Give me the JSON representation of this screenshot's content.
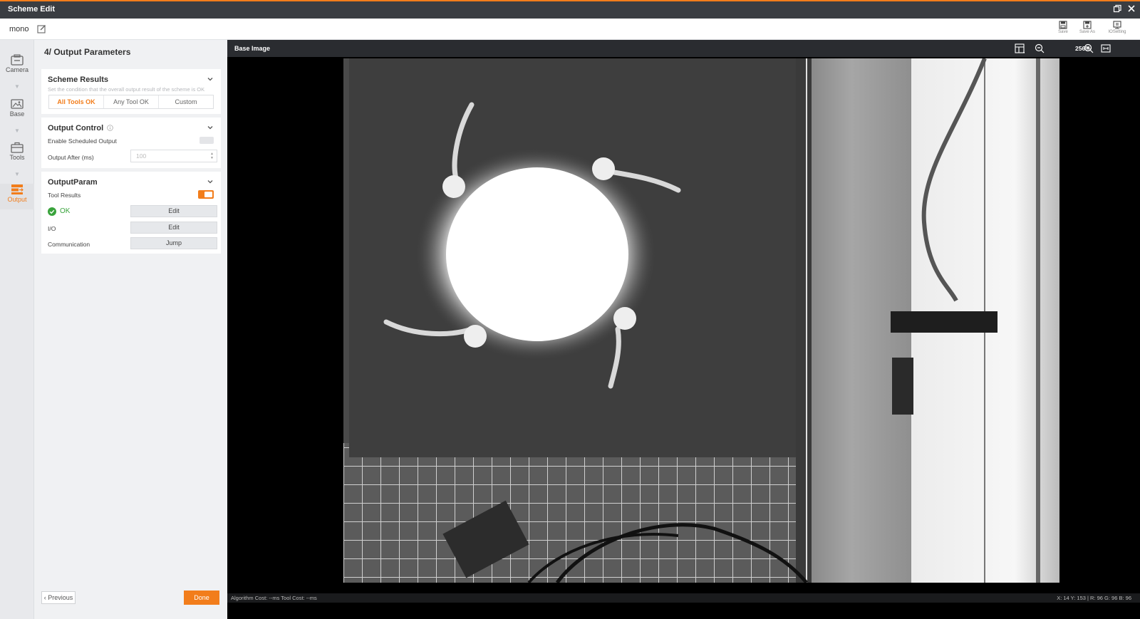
{
  "window": {
    "title": "Scheme Edit"
  },
  "toolbar": {
    "scheme_name": "mono",
    "actions": [
      {
        "label": "Save",
        "icon": "save-icon"
      },
      {
        "label": "Save As",
        "icon": "save-as-icon"
      },
      {
        "label": "IOSetting",
        "icon": "io-setting-icon"
      }
    ]
  },
  "leftnav": {
    "items": [
      {
        "label": "Camera",
        "icon": "camera-icon"
      },
      {
        "label": "Base",
        "icon": "image-icon"
      },
      {
        "label": "Tools",
        "icon": "toolbox-icon"
      },
      {
        "label": "Output",
        "icon": "output-icon",
        "active": true
      }
    ]
  },
  "panel": {
    "title": "4/ Output Parameters",
    "scheme_results": {
      "title": "Scheme Results",
      "description": "Set the condition that the overall output result of the scheme is OK",
      "options": [
        "All Tools OK",
        "Any Tool OK",
        "Custom"
      ],
      "selected": "All Tools OK"
    },
    "output_control": {
      "title": "Output Control",
      "enable_label": "Enable Scheduled Output",
      "enable_value": false,
      "after_label": "Output After (ms)",
      "after_placeholder": "100"
    },
    "output_param": {
      "title": "OutputParam",
      "tool_results_label": "Tool Results",
      "tool_results_value": true,
      "ok_label": "OK",
      "ok_button": "Edit",
      "io_label": "I/O",
      "io_button": "Edit",
      "comm_label": "Communication",
      "comm_button": "Jump"
    },
    "previous": "Previous",
    "done": "Done"
  },
  "viewer": {
    "title": "Base Image",
    "zoom": "256%",
    "status_left": "Algorithm Cost: --ms Tool Cost: --ms",
    "status_right": "X: 14 Y: 153 | R: 96 G: 96 B: 96"
  },
  "colors": {
    "accent": "#f27d1b",
    "ok": "#39a33c",
    "titlebar": "#3a3d42"
  }
}
